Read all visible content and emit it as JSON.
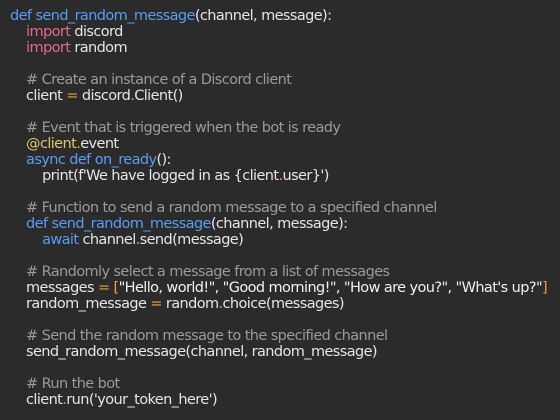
{
  "editor": {
    "lines": [
      [
        {
          "t": "def ",
          "c": "kw"
        },
        {
          "t": "send_random_message",
          "c": "fn"
        },
        {
          "t": "(channel, message):",
          "c": "pl"
        }
      ],
      [
        {
          "t": "    ",
          "c": "pl"
        },
        {
          "t": "import",
          "c": "imp"
        },
        {
          "t": " discord",
          "c": "pl"
        }
      ],
      [
        {
          "t": "    ",
          "c": "pl"
        },
        {
          "t": "import",
          "c": "imp"
        },
        {
          "t": " random",
          "c": "pl"
        }
      ],
      [],
      [
        {
          "t": "    # Create an instance of a Discord client",
          "c": "cm"
        }
      ],
      [
        {
          "t": "    client ",
          "c": "pl"
        },
        {
          "t": "=",
          "c": "op"
        },
        {
          "t": " discord",
          "c": "pl"
        },
        {
          "t": ".",
          "c": "dot"
        },
        {
          "t": "Client()",
          "c": "pl"
        }
      ],
      [],
      [
        {
          "t": "    # Event that is triggered when the bot is ready",
          "c": "cm"
        }
      ],
      [
        {
          "t": "    ",
          "c": "pl"
        },
        {
          "t": "@client",
          "c": "dec"
        },
        {
          "t": ".",
          "c": "dot"
        },
        {
          "t": "event",
          "c": "pl"
        }
      ],
      [
        {
          "t": "    ",
          "c": "pl"
        },
        {
          "t": "async def ",
          "c": "kw"
        },
        {
          "t": "on_ready",
          "c": "fn"
        },
        {
          "t": "():",
          "c": "pl"
        }
      ],
      [
        {
          "t": "        print(f'We have logged in as {client",
          "c": "pl"
        },
        {
          "t": ".",
          "c": "dot"
        },
        {
          "t": "user}')",
          "c": "pl"
        }
      ],
      [],
      [
        {
          "t": "    # Function to send a random message to a specified channel",
          "c": "cm"
        }
      ],
      [
        {
          "t": "    ",
          "c": "pl"
        },
        {
          "t": "def ",
          "c": "kw"
        },
        {
          "t": "send_random_message",
          "c": "fn"
        },
        {
          "t": "(channel, message):",
          "c": "pl"
        }
      ],
      [
        {
          "t": "        ",
          "c": "pl"
        },
        {
          "t": "await",
          "c": "kw"
        },
        {
          "t": " channel",
          "c": "pl"
        },
        {
          "t": ".",
          "c": "dot"
        },
        {
          "t": "send(message)",
          "c": "pl"
        }
      ],
      [],
      [
        {
          "t": "    # Randomly select a message from a list of messages",
          "c": "cm"
        }
      ],
      [
        {
          "t": "    messages ",
          "c": "pl"
        },
        {
          "t": "= [",
          "c": "op"
        },
        {
          "t": "\"Hello, world!\", \"Good morning!\", \"How are you?\", \"What's up?\"",
          "c": "str"
        },
        {
          "t": "]",
          "c": "op"
        }
      ],
      [
        {
          "t": "    random_message ",
          "c": "pl"
        },
        {
          "t": "=",
          "c": "op"
        },
        {
          "t": " random",
          "c": "pl"
        },
        {
          "t": ".",
          "c": "dot"
        },
        {
          "t": "choice(messages)",
          "c": "pl"
        }
      ],
      [],
      [
        {
          "t": "    # Send the random message to the specified channel",
          "c": "cm"
        }
      ],
      [
        {
          "t": "    send_random_message(channel, random_message)",
          "c": "pl"
        }
      ],
      [],
      [
        {
          "t": "    # Run the bot",
          "c": "cm"
        }
      ],
      [
        {
          "t": "    client",
          "c": "pl"
        },
        {
          "t": ".",
          "c": "dot"
        },
        {
          "t": "run('your_token_here')",
          "c": "pl"
        }
      ]
    ]
  }
}
